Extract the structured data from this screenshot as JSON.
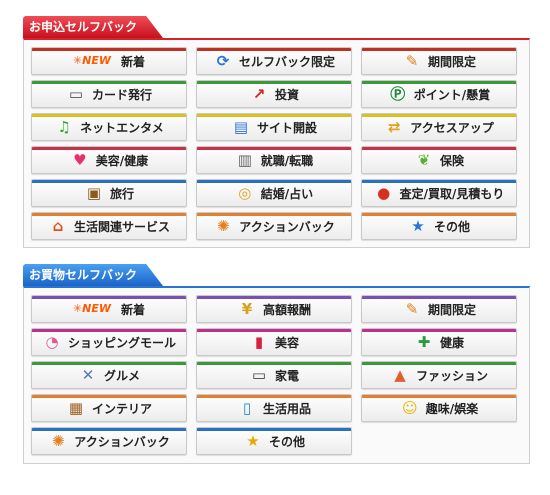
{
  "self_back": {
    "tab_label": "お申込セルフバック",
    "items": [
      {
        "label": "新着",
        "icon": "new-badge-icon",
        "glyph": "NEW",
        "color": "#a04020"
      },
      {
        "label": "セルフバック限定",
        "icon": "refresh-arrows-icon",
        "glyph": "⟳",
        "color": "#2a74d4"
      },
      {
        "label": "期間限定",
        "icon": "ticket-icon",
        "glyph": "✎",
        "color": "#e08020"
      },
      {
        "label": "カード発行",
        "icon": "card-icon",
        "glyph": "▭",
        "color": "#555555"
      },
      {
        "label": "投資",
        "icon": "chart-up-icon",
        "glyph": "↗",
        "color": "#d82020"
      },
      {
        "label": "ポイント/懸賞",
        "icon": "point-p-icon",
        "glyph": "Ⓟ",
        "color": "#1a8a3a"
      },
      {
        "label": "ネットエンタメ",
        "icon": "music-note-icon",
        "glyph": "♫",
        "color": "#3aa030"
      },
      {
        "label": "サイト開設",
        "icon": "browser-window-icon",
        "glyph": "▤",
        "color": "#2a74d4"
      },
      {
        "label": "アクセスアップ",
        "icon": "access-arrows-icon",
        "glyph": "⇄",
        "color": "#e0a020"
      },
      {
        "label": "美容/健康",
        "icon": "heart-cross-icon",
        "glyph": "♥",
        "color": "#e83070"
      },
      {
        "label": "就職/転職",
        "icon": "phone-device-icon",
        "glyph": "▥",
        "color": "#666666"
      },
      {
        "label": "保険",
        "icon": "sprout-icon",
        "glyph": "❦",
        "color": "#5ab030"
      },
      {
        "label": "旅行",
        "icon": "suitcase-icon",
        "glyph": "▣",
        "color": "#8a5a20"
      },
      {
        "label": "結婚/占い",
        "icon": "ring-icon",
        "glyph": "◎",
        "color": "#e0a020"
      },
      {
        "label": "査定/買取/見積もり",
        "icon": "purse-icon",
        "glyph": "●",
        "color": "#d83020"
      },
      {
        "label": "生活関連サービス",
        "icon": "house-icon",
        "glyph": "⌂",
        "color": "#e05020"
      },
      {
        "label": "アクションバック",
        "icon": "action-figure-icon",
        "glyph": "✺",
        "color": "#e08020"
      },
      {
        "label": "その他",
        "icon": "star-icon",
        "glyph": "★",
        "color": "#2a74d4"
      }
    ]
  },
  "shopping_back": {
    "tab_label": "お買物セルフバック",
    "items": [
      {
        "label": "新着",
        "icon": "new-badge-icon",
        "glyph": "NEW",
        "color": "#a04020"
      },
      {
        "label": "高額報酬",
        "icon": "yen-coin-icon",
        "glyph": "¥",
        "color": "#d8a020"
      },
      {
        "label": "期間限定",
        "icon": "ticket-icon",
        "glyph": "✎",
        "color": "#e08020"
      },
      {
        "label": "ショッピングモール",
        "icon": "shopping-bag-icon",
        "glyph": "◔",
        "color": "#e05a90"
      },
      {
        "label": "美容",
        "icon": "lipstick-icon",
        "glyph": "▮",
        "color": "#d82040"
      },
      {
        "label": "健康",
        "icon": "first-aid-icon",
        "glyph": "✚",
        "color": "#2a9a3a"
      },
      {
        "label": "グルメ",
        "icon": "fork-knife-icon",
        "glyph": "✕",
        "color": "#5a7ab0"
      },
      {
        "label": "家電",
        "icon": "monitor-icon",
        "glyph": "▭",
        "color": "#444444"
      },
      {
        "label": "ファッション",
        "icon": "shirt-icon",
        "glyph": "▲",
        "color": "#e06030"
      },
      {
        "label": "インテリア",
        "icon": "furniture-icon",
        "glyph": "▦",
        "color": "#a06020"
      },
      {
        "label": "生活用品",
        "icon": "bottles-icon",
        "glyph": "▯",
        "color": "#2a8ac8"
      },
      {
        "label": "趣味/娯楽",
        "icon": "smile-icon",
        "glyph": "☺",
        "color": "#e8b800"
      },
      {
        "label": "アクションバック",
        "icon": "action-figure-icon",
        "glyph": "✺",
        "color": "#e08020"
      },
      {
        "label": "その他",
        "icon": "star-icon",
        "glyph": "★",
        "color": "#e8a800"
      }
    ]
  }
}
